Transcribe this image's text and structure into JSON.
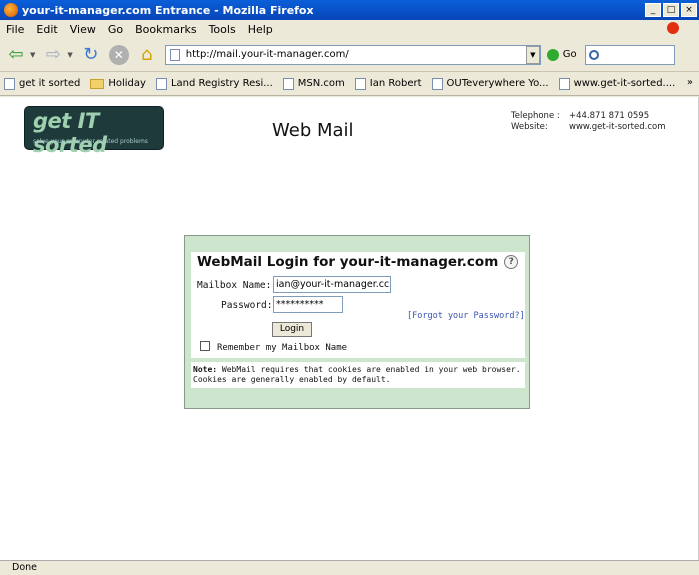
{
  "window": {
    "title": "your-it-manager.com Entrance - Mozilla Firefox"
  },
  "menu": {
    "items": [
      "File",
      "Edit",
      "View",
      "Go",
      "Bookmarks",
      "Tools",
      "Help"
    ]
  },
  "toolbar": {
    "url": "http://mail.your-it-manager.com/",
    "go_label": "Go"
  },
  "bookmarks": {
    "items": [
      {
        "label": "get it sorted",
        "icon": "page-icon"
      },
      {
        "label": "Holiday",
        "icon": "folder-icon"
      },
      {
        "label": "Land Registry Resi...",
        "icon": "page-icon"
      },
      {
        "label": "MSN.com",
        "icon": "page-icon"
      },
      {
        "label": "Ian Robert",
        "icon": "page-icon"
      },
      {
        "label": "OUTeverywhere Yo...",
        "icon": "page-icon"
      },
      {
        "label": "www.get-it-sorted....",
        "icon": "page-icon"
      }
    ],
    "more": "»"
  },
  "header": {
    "logo_text": "get IT sorted",
    "logo_tagline": "solve your computer related problems",
    "page_title": "Web Mail",
    "telephone_label": "Telephone :",
    "telephone_value": "+44.871 871 0595",
    "website_label": "Website:",
    "website_value": "www.get-it-sorted.com"
  },
  "login": {
    "heading": "WebMail Login for your-it-manager.com",
    "mailbox_label": "Mailbox Name:",
    "mailbox_value": "ian@your-it-manager.cc",
    "password_label": "Password:",
    "password_value": "**********",
    "forgot_link": "[Forgot your Password?]",
    "login_button": "Login",
    "remember_label": "Remember my Mailbox Name",
    "note_label": "Note:",
    "note_text": "WebMail requires that cookies are enabled in your web browser. Cookies are generally enabled by default."
  },
  "status": {
    "text": "Done"
  },
  "colors": {
    "panel_bg": "#cde5cd",
    "logo_bg": "#1e3a3a",
    "link": "#3a55b0"
  }
}
